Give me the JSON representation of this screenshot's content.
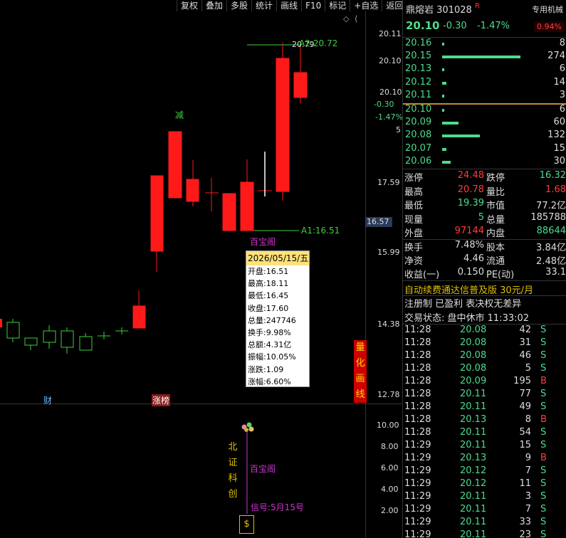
{
  "toolbar": [
    "复权",
    "叠加",
    "多股",
    "统计",
    "画线",
    "F10",
    "标记",
    "+自选",
    "返回"
  ],
  "chart": {
    "price_axis": [
      "20.11",
      "20.10",
      "17.59",
      "15.99",
      "14.38",
      "12.78"
    ],
    "current_price_tag": "16.57",
    "pct_axis": [
      "20.10",
      "-0.30",
      "-1.47%",
      "5"
    ],
    "volume_axis": [
      "10.00",
      "8.00",
      "6.00",
      "4.00",
      "2.00"
    ],
    "high_label": "20.79",
    "high_line_label": "A2:20.72",
    "low_line_label": "A1:16.51",
    "marker_jian": "减",
    "marker_baobaoge": "百宝阁",
    "marker_baobaoge2": "百宝阁",
    "marker_cai": "财",
    "marker_zhangbang": "涨榜",
    "vert_quant": [
      "量",
      "化",
      "画",
      "线"
    ],
    "vert_bzkc": [
      "北",
      "证",
      "科",
      "创"
    ],
    "signal_label": "信号:5月15号"
  },
  "tooltip": {
    "date": "2026/05/15/五",
    "lines": [
      "开盘:16.51",
      "最高:18.11",
      "最低:16.45",
      "收盘:17.60",
      "总量:247746",
      "换手:9.98%",
      "总额:4.31亿",
      "振幅:10.05%",
      "涨跌:1.09",
      "涨幅:6.60%"
    ]
  },
  "panel": {
    "name": "鼎熔岩",
    "code": "301028",
    "r_mark": "R",
    "tag": "专用机械",
    "price": "20.10",
    "change": "-0.30",
    "pct": "-1.47%",
    "badge": "0.94%",
    "sell_orders": [
      {
        "price": "20.16",
        "vol": "8",
        "bar": 0.03
      },
      {
        "price": "20.15",
        "vol": "274",
        "bar": 1.0
      },
      {
        "price": "20.13",
        "vol": "6",
        "bar": 0.02
      },
      {
        "price": "20.12",
        "vol": "14",
        "bar": 0.05
      },
      {
        "price": "20.11",
        "vol": "3",
        "bar": 0.01
      }
    ],
    "buy_orders": [
      {
        "price": "20.10",
        "vol": "6",
        "bar": 0.02
      },
      {
        "price": "20.09",
        "vol": "60",
        "bar": 0.21
      },
      {
        "price": "20.08",
        "vol": "132",
        "bar": 0.48
      },
      {
        "price": "20.07",
        "vol": "15",
        "bar": 0.05
      },
      {
        "price": "20.06",
        "vol": "30",
        "bar": 0.11
      }
    ],
    "quote": [
      {
        "l1": "涨停",
        "v1": "24.48",
        "c1": "red",
        "l2": "跌停",
        "v2": "16.32",
        "c2": "green"
      },
      {
        "l1": "最高",
        "v1": "20.78",
        "c1": "red",
        "l2": "量比",
        "v2": "1.68",
        "c2": "red"
      },
      {
        "l1": "最低",
        "v1": "19.39",
        "c1": "green",
        "l2": "市值",
        "v2": "77.2亿",
        "c2": "white"
      },
      {
        "l1": "现量",
        "v1": "5",
        "c1": "green",
        "l2": "总量",
        "v2": "185788",
        "c2": "white"
      },
      {
        "l1": "外盘",
        "v1": "97144",
        "c1": "red",
        "l2": "内盘",
        "v2": "88644",
        "c2": "green"
      }
    ],
    "quote2": [
      {
        "l1": "换手",
        "v1": "7.48%",
        "l2": "股本",
        "v2": "3.84亿"
      },
      {
        "l1": "净资",
        "v1": "4.46",
        "l2": "流通",
        "v2": "2.48亿"
      },
      {
        "l1": "收益(一)",
        "v1": "0.150",
        "l2": "PE(动)",
        "v2": "33.1"
      }
    ],
    "ad_text": "自动续费通达信普及版  30元/月",
    "reg_text": "注册制 已盈利 表决权无差异",
    "status_text": "交易状态: 盘中休市 11:33:02",
    "ticks": [
      {
        "t": "11:28",
        "p": "20.08",
        "v": "42",
        "s": "S"
      },
      {
        "t": "11:28",
        "p": "20.08",
        "v": "31",
        "s": "S"
      },
      {
        "t": "11:28",
        "p": "20.08",
        "v": "46",
        "s": "S"
      },
      {
        "t": "11:28",
        "p": "20.08",
        "v": "5",
        "s": "S"
      },
      {
        "t": "11:28",
        "p": "20.09",
        "v": "195",
        "s": "B"
      },
      {
        "t": "11:28",
        "p": "20.11",
        "v": "77",
        "s": "S"
      },
      {
        "t": "11:28",
        "p": "20.11",
        "v": "49",
        "s": "S"
      },
      {
        "t": "11:28",
        "p": "20.13",
        "v": "8",
        "s": "B"
      },
      {
        "t": "11:28",
        "p": "20.11",
        "v": "54",
        "s": "S"
      },
      {
        "t": "11:29",
        "p": "20.11",
        "v": "15",
        "s": "S"
      },
      {
        "t": "11:29",
        "p": "20.13",
        "v": "9",
        "s": "B"
      },
      {
        "t": "11:29",
        "p": "20.12",
        "v": "7",
        "s": "S"
      },
      {
        "t": "11:29",
        "p": "20.12",
        "v": "11",
        "s": "S"
      },
      {
        "t": "11:29",
        "p": "20.11",
        "v": "3",
        "s": "S"
      },
      {
        "t": "11:29",
        "p": "20.11",
        "v": "7",
        "s": "S"
      },
      {
        "t": "11:29",
        "p": "20.11",
        "v": "33",
        "s": "S"
      },
      {
        "t": "11:29",
        "p": "20.11",
        "v": "23",
        "s": "S"
      }
    ]
  }
}
